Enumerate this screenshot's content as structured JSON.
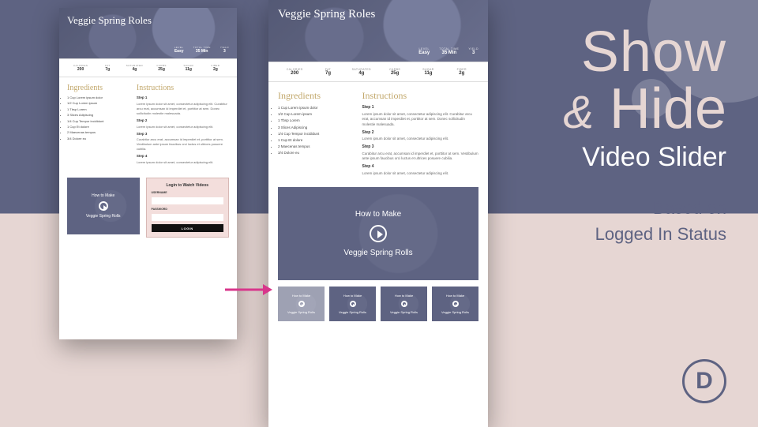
{
  "headline": {
    "line1": "Show",
    "amp": "&",
    "line2": "Hide",
    "line3": "Video Slider",
    "sub1": "Based on",
    "sub2": "Logged In Status"
  },
  "logo_letter": "D",
  "recipe": {
    "title": "Veggie Spring Roles",
    "meta": {
      "level_label": "LEVEL",
      "level_value": "Easy",
      "time_label": "TOTAL TIME",
      "time_value": "35 Min",
      "yield_label": "YIELD",
      "yield_value": "3"
    },
    "nutri": [
      {
        "label": "CALORIES",
        "value": "200"
      },
      {
        "label": "FAT",
        "value": "7g"
      },
      {
        "label": "SATURATED",
        "value": "4g"
      },
      {
        "label": "CARBS",
        "value": "25g"
      },
      {
        "label": "SUGAR",
        "value": "11g"
      },
      {
        "label": "FIBER",
        "value": "2g"
      }
    ],
    "ingredients_heading": "Ingredients",
    "ingredients": [
      "1 Cup Lorem ipsum dolor",
      "1/2 Cup Lorem ipsum",
      "1 Tbsp Lorem",
      "3 Slices Adipiscing",
      "1/4 Cup Tempor incididunt",
      "1 Cup Et dolore",
      "2 Maecenas tempus",
      "3/4 Dolore eu"
    ],
    "instructions_heading": "Instructions",
    "steps": [
      {
        "h": "Step 1",
        "t": "Lorem ipsum dolor sit amet, consectetur adipiscing elit. Curabitur arcu erat, accumsan id imperdiet et, porttitor at sem. Donec sollicitudin molestie malesuada."
      },
      {
        "h": "Step 2",
        "t": "Lorem ipsum dolor sit amet, consectetur adipiscing elit."
      },
      {
        "h": "Step 3",
        "t": "Curabitur arcu erat, accumsan id imperdiet et, porttitor at sem. Vestibulum ante ipsum faucibus orci luctus et ultrices posuere cubilia."
      },
      {
        "h": "Step 4",
        "t": "Lorem ipsum dolor sit amet, consectetur adipiscing elit."
      }
    ]
  },
  "video": {
    "eyebrow": "How to Make",
    "title": "Veggie Spring Rolls"
  },
  "login": {
    "heading": "Login to Watch Videos",
    "user_label": "USERNAME",
    "pass_label": "PASSWORD",
    "button": "LOGIN"
  },
  "thumbs": [
    {
      "eyebrow": "How to Make",
      "title": "Veggie Spring Rolls"
    },
    {
      "eyebrow": "How to Make",
      "title": "Veggie Spring Rolls"
    },
    {
      "eyebrow": "How to Make",
      "title": "Veggie Spring Rolls"
    },
    {
      "eyebrow": "How to Make",
      "title": "Veggie Spring Rolls"
    }
  ]
}
